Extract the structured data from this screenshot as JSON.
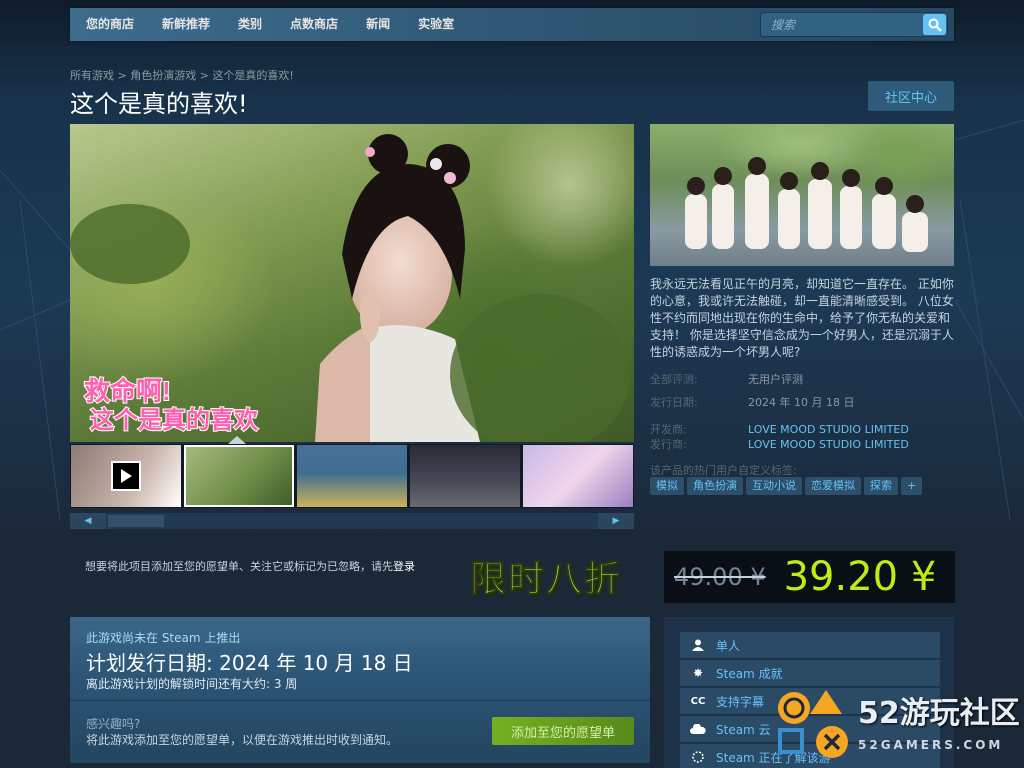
{
  "nav": {
    "items": [
      "您的商店",
      "新鲜推荐",
      "类别",
      "点数商店",
      "新闻",
      "实验室"
    ],
    "search_placeholder": "搜索",
    "search_icon": "search-icon"
  },
  "breadcrumb": [
    "所有游戏",
    "角色扮演游戏",
    "这个是真的喜欢!"
  ],
  "breadcrumb_sep": ">",
  "title": "这个是真的喜欢!",
  "community_hub": "社区中心",
  "media": {
    "logo_text_line1": "救命啊!",
    "logo_text_line2": "这个是真的喜欢"
  },
  "description": "我永远无法看见正午的月亮，却知道它一直存在。 正如你的心意，我或许无法触碰，却一直能清晰感受到。 八位女性不约而同地出现在你的生命中，给予了你无私的关爱和支持！ 你是选择坚守信念成为一个好男人，还是沉溺于人性的诱惑成为一个坏男人呢?",
  "reviews": {
    "label": "全部评测:",
    "value": "无用户评测"
  },
  "release": {
    "label": "发行日期:",
    "value": "2024 年 10 月 18 日"
  },
  "developer": {
    "label": "开发商:",
    "value": "LOVE MOOD STUDIO LIMITED"
  },
  "publisher": {
    "label": "发行商:",
    "value": "LOVE MOOD STUDIO LIMITED"
  },
  "tags_label": "该产品的热门用户自定义标签:",
  "tags": [
    "模拟",
    "角色扮演",
    "互动小说",
    "恋爱模拟",
    "探索",
    "+"
  ],
  "login_bar": {
    "text": "想要将此项目添加至您的愿望单、关注它或标记为已忽略，请先",
    "link": "登录"
  },
  "promo": "限时八折",
  "price": {
    "original": "49.00 ¥",
    "final": "39.20 ¥"
  },
  "coming_soon": {
    "note": "此游戏尚未在 Steam 上推出",
    "date": "计划发行日期: 2024 年 10 月 18 日",
    "countdown": "离此游戏计划的解锁时间还有大约: 3 周",
    "interest": "感兴趣吗?",
    "interest_desc": "将此游戏添加至您的愿望单，以便在游戏推出时收到通知。",
    "wishlist_button": "添加至您的愿望单"
  },
  "features": [
    {
      "icon": "single-player-icon",
      "label": "单人"
    },
    {
      "icon": "achievements-icon",
      "label": "Steam 成就"
    },
    {
      "icon": "captions-icon",
      "label": "支持字幕"
    },
    {
      "icon": "cloud-icon",
      "label": "Steam 云"
    },
    {
      "icon": "learning-icon",
      "label": "Steam 正在了解该游"
    }
  ],
  "watermark": {
    "text": "52游玩社区",
    "sub": "52GAMERS.COM"
  },
  "colors": {
    "background": "#1b2838",
    "link": "#67c1f5",
    "price_final": "#beee11",
    "promo": "#c7f27a",
    "wishlist_button": "#75b022"
  }
}
